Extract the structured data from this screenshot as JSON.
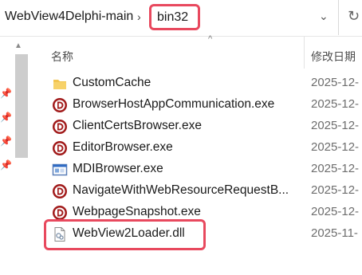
{
  "address": {
    "parent": "WebView4Delphi-main",
    "separator": "›",
    "current": "bin32",
    "dropdown_glyph": "⌄",
    "refresh_glyph": "↻"
  },
  "nav": {
    "scroll_up_glyph": "▲",
    "pin_glyph": "📌"
  },
  "columns": {
    "name": "名称",
    "date": "修改日期",
    "sort_glyph": "^"
  },
  "files": [
    {
      "name": "CustomCache",
      "date": "2025-12-",
      "icon": "folder-icon"
    },
    {
      "name": "BrowserHostAppCommunication.exe",
      "date": "2025-12-",
      "icon": "delphi-app-icon"
    },
    {
      "name": "ClientCertsBrowser.exe",
      "date": "2025-12-",
      "icon": "delphi-app-icon"
    },
    {
      "name": "EditorBrowser.exe",
      "date": "2025-12-",
      "icon": "delphi-app-icon"
    },
    {
      "name": "MDIBrowser.exe",
      "date": "2025-12-",
      "icon": "window-app-icon"
    },
    {
      "name": "NavigateWithWebResourceRequestB...",
      "date": "2025-12-",
      "icon": "delphi-app-icon"
    },
    {
      "name": "WebpageSnapshot.exe",
      "date": "2025-12-",
      "icon": "delphi-app-icon"
    },
    {
      "name": "WebView2Loader.dll",
      "date": "2025-11-",
      "icon": "dll-file-icon"
    }
  ],
  "colors": {
    "highlight": "#e8495e",
    "delphi_red": "#a11a1a",
    "folder": "#f2c44f"
  }
}
